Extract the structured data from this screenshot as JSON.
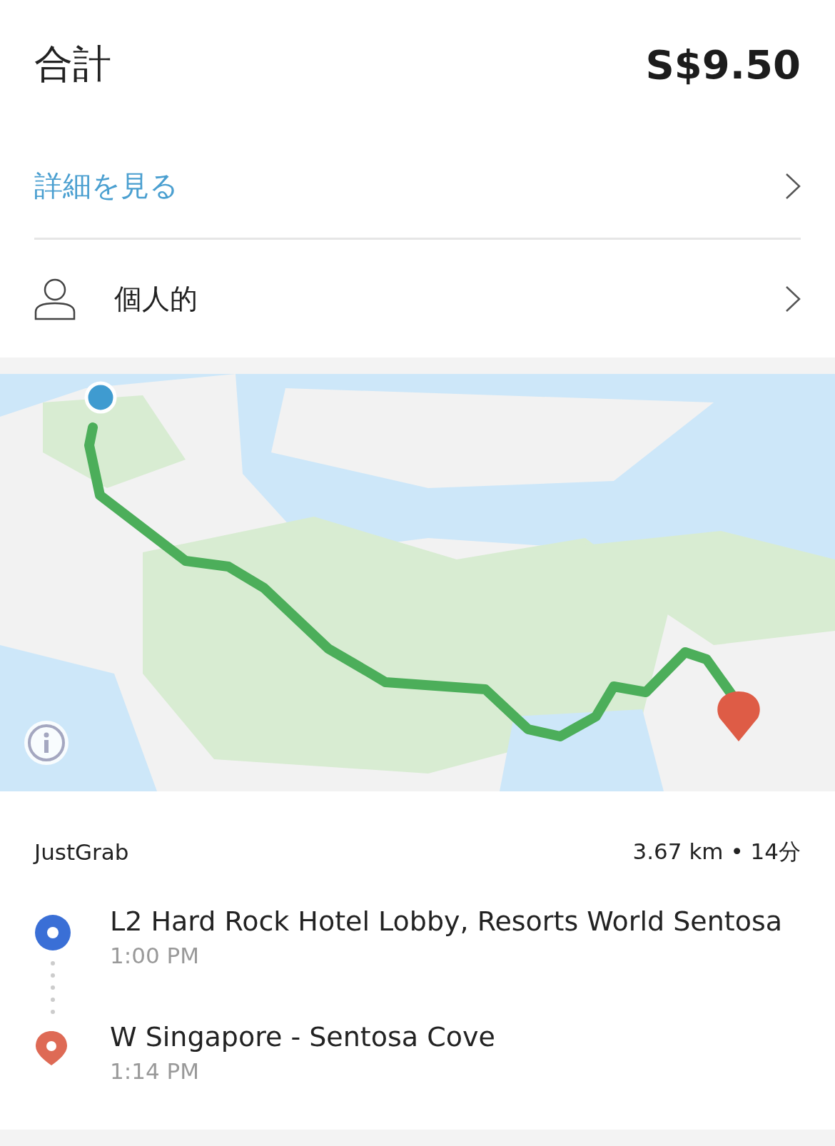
{
  "total": {
    "label": "合計",
    "amount": "S$9.50"
  },
  "details_link": {
    "label": "詳細を見る"
  },
  "profile": {
    "label": "個人的"
  },
  "trip": {
    "service": "JustGrab",
    "summary": "3.67 km • 14分",
    "stops": [
      {
        "kind": "pickup",
        "name": "L2 Hard Rock Hotel Lobby, Resorts World Sentosa",
        "time": "1:00 PM"
      },
      {
        "kind": "dropoff",
        "name": "W Singapore - Sentosa Cove",
        "time": "1:14 PM"
      }
    ]
  }
}
